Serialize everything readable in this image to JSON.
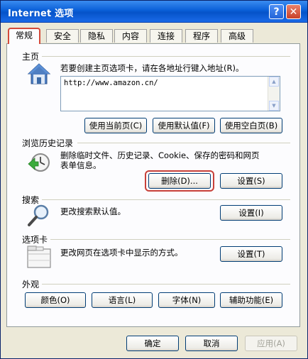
{
  "window": {
    "title": "Internet 选项",
    "help_label": "?",
    "close_label": "✕"
  },
  "tabs": [
    {
      "label": "常规"
    },
    {
      "label": "安全"
    },
    {
      "label": "隐私"
    },
    {
      "label": "内容"
    },
    {
      "label": "连接"
    },
    {
      "label": "程序"
    },
    {
      "label": "高级"
    }
  ],
  "home": {
    "title": "主页",
    "description": "若要创建主页选项卡，请在各地址行键入地址(R)。",
    "url": "http://www.amazon.cn/",
    "buttons": [
      "使用当前页(C)",
      "使用默认值(F)",
      "使用空白页(B)"
    ],
    "icon": "house-icon"
  },
  "history": {
    "title": "浏览历史记录",
    "description_line1": "删除临时文件、历史记录、Cookie、保存的密码和网页",
    "description_line2": "表单信息。",
    "delete_label": "删除(D)...",
    "settings_label": "设置(S)",
    "icon": "history-clock-icon"
  },
  "search": {
    "title": "搜索",
    "description": "更改搜索默认值。",
    "settings_label": "设置(I)",
    "icon": "magnifier-icon"
  },
  "tabsection": {
    "title": "选项卡",
    "description": "更改网页在选项卡中显示的方式。",
    "settings_label": "设置(T)",
    "icon": "tabs-window-icon"
  },
  "appearance": {
    "title": "外观",
    "buttons": [
      "颜色(O)",
      "语言(L)",
      "字体(N)",
      "辅助功能(E)"
    ]
  },
  "footer": {
    "ok": "确定",
    "cancel": "取消",
    "apply": "应用(A)"
  },
  "colors": {
    "title_bar": "#0a5fd8",
    "dialog_bg": "#ece9d8",
    "highlight": "#c8413a"
  }
}
